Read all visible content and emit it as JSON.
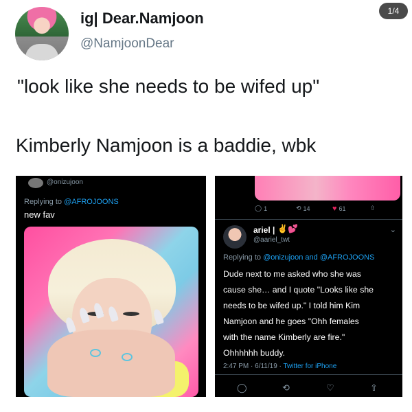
{
  "header": {
    "counter": "1/4",
    "display_name": "ig| Dear.Namjoon",
    "handle": "@NamjoonDear"
  },
  "tweet": {
    "line1": "\"look like she needs to be wifed up\"",
    "line2": "Kimberly Namjoon is a baddie, wbk"
  },
  "left_screenshot": {
    "handle": "@onizujoon",
    "reply_prefix": "Replying to",
    "reply_target": "@AFROJOONS",
    "text": "new fav"
  },
  "right_screenshot": {
    "stats": [
      {
        "icon": "reply-icon",
        "label": "1"
      },
      {
        "icon": "retweet-icon",
        "label": "14"
      },
      {
        "icon": "heart-icon",
        "label": "61"
      },
      {
        "icon": "share-icon",
        "label": ""
      }
    ],
    "name": "ariel |",
    "handle": "@aariel_twt",
    "reply_prefix": "Replying to",
    "reply_target": "@onizujoon and @AFROJOONS",
    "lines": [
      "Dude next to me asked who she was",
      "cause she… and I quote \"Looks like she",
      "needs to be wifed up.\" I told him Kim",
      "Namjoon and he goes \"Ohh females",
      "with the name Kimberly are fire.\"",
      "Ohhhhhh buddy."
    ],
    "timestamp": "2:47 PM · 6/11/19 ·",
    "source": "Twitter for iPhone"
  },
  "colors": {
    "link_blue": "#1da1f2",
    "muted": "#8899a6",
    "like_red": "#e0245e"
  }
}
